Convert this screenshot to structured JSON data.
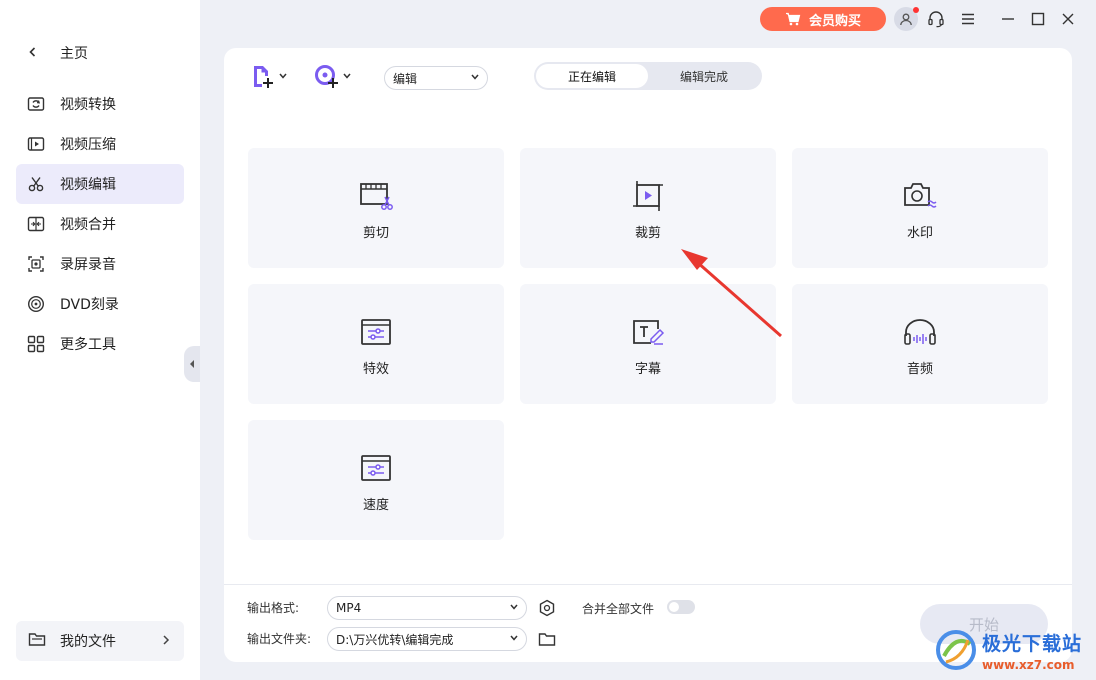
{
  "titlebar": {
    "vip_label": "会员购买"
  },
  "sidebar": {
    "home_label": "主页",
    "items": [
      {
        "label": "视频转换",
        "icon": "video-convert-icon"
      },
      {
        "label": "视频压缩",
        "icon": "video-compress-icon"
      },
      {
        "label": "视频编辑",
        "icon": "scissors-icon",
        "active": true
      },
      {
        "label": "视频合并",
        "icon": "video-merge-icon"
      },
      {
        "label": "录屏录音",
        "icon": "screen-record-icon"
      },
      {
        "label": "DVD刻录",
        "icon": "disc-icon"
      },
      {
        "label": "更多工具",
        "icon": "grid-icon"
      }
    ],
    "my_files_label": "我的文件"
  },
  "toolbar": {
    "mode_select": "编辑",
    "tabs": [
      {
        "label": "正在编辑",
        "selected": true
      },
      {
        "label": "编辑完成",
        "selected": false
      }
    ]
  },
  "tools": [
    {
      "label": "剪切",
      "icon": "film-cut-icon"
    },
    {
      "label": "裁剪",
      "icon": "crop-icon"
    },
    {
      "label": "水印",
      "icon": "camera-watermark-icon"
    },
    {
      "label": "特效",
      "icon": "effects-sliders-icon"
    },
    {
      "label": "字幕",
      "icon": "subtitle-icon"
    },
    {
      "label": "音频",
      "icon": "headphones-icon"
    },
    {
      "label": "速度",
      "icon": "speed-sliders-icon"
    }
  ],
  "footer": {
    "format_label": "输出格式:",
    "format_value": "MP4",
    "folder_label": "输出文件夹:",
    "folder_value": "D:\\万兴优转\\编辑完成",
    "merge_label": "合并全部文件",
    "merge_on": false,
    "start_label": "开始"
  },
  "watermark": {
    "title": "极光下载站",
    "url": "www.xz7.com"
  },
  "colors": {
    "accent": "#7b5cf0",
    "vip": "#ff6a4d",
    "active_bg": "#ecebfb",
    "annotation": "#e8372f"
  }
}
